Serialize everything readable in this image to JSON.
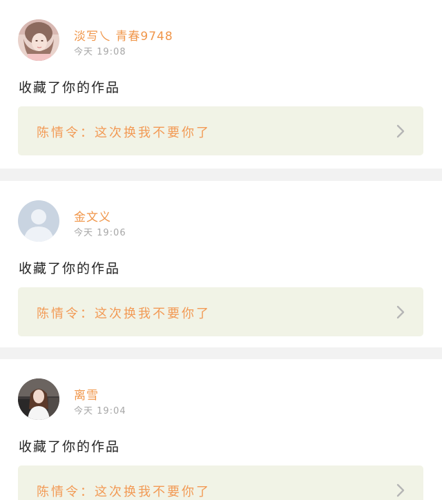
{
  "notifications": [
    {
      "username": "淡写乀 青春9748",
      "time": "今天 19:08",
      "action": "收藏了你的作品",
      "work_title": "陈情令：这次换我不要你了",
      "avatar": "photo-avatar-girl-pink"
    },
    {
      "username": "金文义",
      "time": "今天 19:06",
      "action": "收藏了你的作品",
      "work_title": "陈情令：这次换我不要你了",
      "avatar": "default-user-avatar"
    },
    {
      "username": "离雪",
      "time": "今天 19:04",
      "action": "收藏了你的作品",
      "work_title": "陈情令：这次换我不要你了",
      "avatar": "photo-avatar-girl-dark"
    }
  ],
  "colors": {
    "username": "#f0964a",
    "work_title": "#f29a55",
    "work_background": "#f1f3e6",
    "time": "#a6a6a6",
    "page_background": "#f2f2f2"
  }
}
